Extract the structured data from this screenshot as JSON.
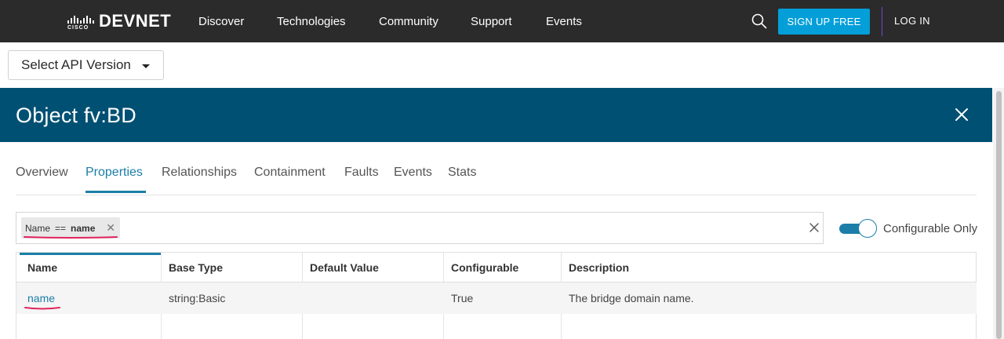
{
  "nav": {
    "logo_small": "CISCO",
    "logo_word": "DEVNET",
    "links": [
      "Discover",
      "Technologies",
      "Community",
      "Support",
      "Events"
    ],
    "signup_label": "SIGN UP FREE",
    "login_label": "LOG IN",
    "accent": "#049fd9"
  },
  "api_version": {
    "label": "Select API Version"
  },
  "object": {
    "title": "Object fv:BD",
    "header_color": "#005073"
  },
  "tabs": [
    {
      "label": "Overview",
      "active": false
    },
    {
      "label": "Properties",
      "active": true
    },
    {
      "label": "Relationships",
      "active": false
    },
    {
      "label": "Containment",
      "active": false
    },
    {
      "label": "Faults",
      "active": false
    },
    {
      "label": "Events",
      "active": false
    },
    {
      "label": "Stats",
      "active": false
    }
  ],
  "filter": {
    "chip": {
      "key": "Name",
      "operator": "==",
      "value": "name"
    },
    "toggle_label": "Configurable Only",
    "toggle_on": true
  },
  "table": {
    "columns": [
      "Name",
      "Base Type",
      "Default Value",
      "Configurable",
      "Description"
    ],
    "rows": [
      {
        "name": "name",
        "base_type": "string:Basic",
        "default_value": "",
        "configurable": "True",
        "description": "The bridge domain name."
      }
    ]
  },
  "icons": {
    "search": "search-icon",
    "close": "close-icon",
    "caret": "chevron-down-icon",
    "chip_remove": "close-icon"
  }
}
